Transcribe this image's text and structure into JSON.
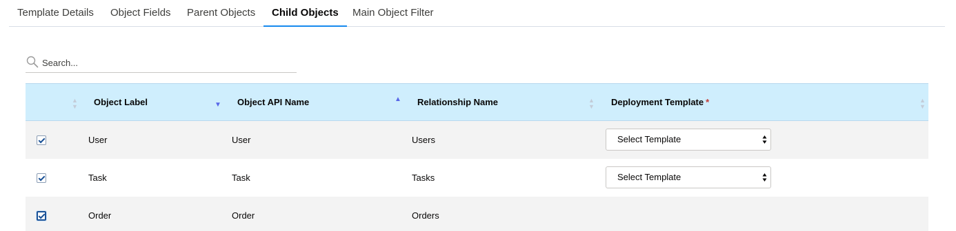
{
  "tabs": [
    {
      "label": "Template Details",
      "active": false
    },
    {
      "label": "Object Fields",
      "active": false
    },
    {
      "label": "Parent Objects",
      "active": false
    },
    {
      "label": "Child Objects",
      "active": true
    },
    {
      "label": "Main Object Filter",
      "active": false
    }
  ],
  "search": {
    "placeholder": "Search..."
  },
  "table": {
    "columns": {
      "object_label": "Object Label",
      "object_api_name": "Object API Name",
      "relationship_name": "Relationship Name",
      "deployment_template": "Deployment Template",
      "required_mark": "*"
    },
    "sort": {
      "object_label": "descending",
      "object_api_name": "ascending"
    },
    "rows": [
      {
        "selected": true,
        "object_label": "User",
        "object_api_name": "User",
        "relationship_name": "Users",
        "deployment_template": "Select Template"
      },
      {
        "selected": true,
        "object_label": "Task",
        "object_api_name": "Task",
        "relationship_name": "Tasks",
        "deployment_template": "Select Template"
      },
      {
        "selected": true,
        "object_label": "Order",
        "object_api_name": "Order",
        "relationship_name": "Orders",
        "deployment_template": ""
      }
    ]
  },
  "colors": {
    "header_bg": "#cfeefd",
    "active_tab_underline": "#1589ee",
    "sort_arrow_active": "#5867e8",
    "required": "#c23934"
  },
  "icons": {
    "search": "search-icon",
    "sort": "sort-arrow-icon",
    "select": "select-arrows-icon",
    "checkbox": "checkbox-checked-icon"
  }
}
